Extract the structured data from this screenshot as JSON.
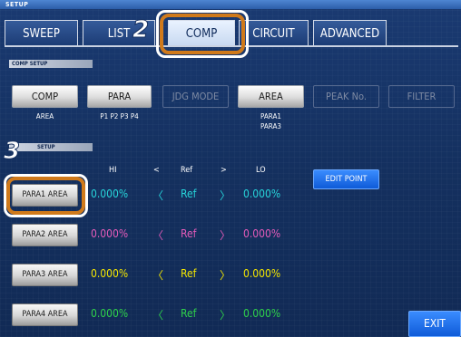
{
  "header": {
    "title": "SETUP"
  },
  "tabs": [
    {
      "label": "SWEEP",
      "active": false
    },
    {
      "label": "LIST",
      "active": false
    },
    {
      "label": "COMP",
      "active": true
    },
    {
      "label": "CIRCUIT",
      "active": false
    },
    {
      "label": "ADVANCED",
      "active": false
    }
  ],
  "comp_setup": {
    "section_label": "COMP SETUP",
    "buttons": [
      {
        "label": "COMP",
        "enabled": true,
        "caption": "AREA"
      },
      {
        "label": "PARA",
        "enabled": true,
        "caption": "P1 P2 P3 P4"
      },
      {
        "label": "JDG MODE",
        "enabled": false,
        "caption": ""
      },
      {
        "label": "AREA",
        "enabled": true,
        "caption_lines": [
          "PARA1",
          "PARA3"
        ]
      },
      {
        "label": "PEAK No.",
        "enabled": false,
        "caption": ""
      },
      {
        "label": "FILTER",
        "enabled": false,
        "caption": ""
      }
    ]
  },
  "area_setup": {
    "section_label": "SETUP",
    "columns": {
      "hi": "HI",
      "lt": "<",
      "ref": "Ref",
      "gt": ">",
      "lo": "LO"
    },
    "rows": [
      {
        "button": "PARA1 AREA",
        "hi": "0.000%",
        "left_mark": "〈",
        "ref": "Ref",
        "right_mark": "〉",
        "lo": "0.000%",
        "color": "#27d3d9"
      },
      {
        "button": "PARA2 AREA",
        "hi": "0.000%",
        "left_mark": "〈",
        "ref": "Ref",
        "right_mark": "〉",
        "lo": "0.000%",
        "color": "#e45bb9"
      },
      {
        "button": "PARA3 AREA",
        "hi": "0.000%",
        "left_mark": "〈",
        "ref": "Ref",
        "right_mark": "〉",
        "lo": "0.000%",
        "color": "#f2e600"
      },
      {
        "button": "PARA4 AREA",
        "hi": "0.000%",
        "left_mark": "〈",
        "ref": "Ref",
        "right_mark": "〉",
        "lo": "0.000%",
        "color": "#2fd14a"
      }
    ],
    "edit_point": "EDIT POINT"
  },
  "footer": {
    "exit": "EXIT"
  },
  "callouts": {
    "step_comp": "2",
    "step_para1": "3"
  },
  "colors": {
    "callout": "#d07a1b",
    "active_tab": "#e0ecff",
    "blue_button": "#1f6ff0"
  }
}
